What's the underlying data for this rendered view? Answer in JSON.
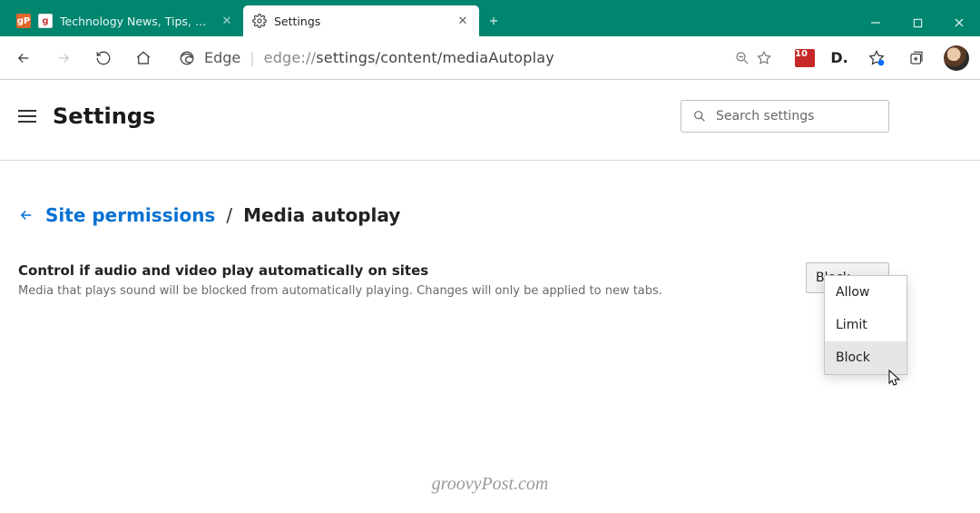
{
  "tabs": [
    {
      "label": "Technology News, Tips, Reviews,",
      "favicon1": "gP",
      "favicon2": "g"
    },
    {
      "label": "Settings"
    }
  ],
  "toolbar": {
    "edge_label": "Edge",
    "url_prefix": "edge://",
    "url_rest": "settings/content/mediaAutoplay",
    "ext_lp_badge": "10",
    "ext_d_label": "D."
  },
  "settings": {
    "title": "Settings",
    "search_placeholder": "Search settings"
  },
  "breadcrumb": {
    "parent": "Site permissions",
    "sep": "/",
    "leaf": "Media autoplay"
  },
  "autoplay": {
    "heading": "Control if audio and video play automatically on sites",
    "sub": "Media that plays sound will be blocked from automatically playing. Changes will only be applied to new tabs.",
    "selected": "Block",
    "options": [
      "Allow",
      "Limit",
      "Block"
    ],
    "hover_index": 2
  },
  "watermark": "groovyPost.com"
}
